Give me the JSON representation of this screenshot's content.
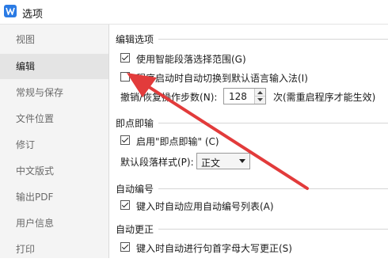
{
  "window": {
    "title": "选项"
  },
  "sidebar": {
    "items": [
      {
        "label": "视图"
      },
      {
        "label": "编辑"
      },
      {
        "label": "常规与保存"
      },
      {
        "label": "文件位置"
      },
      {
        "label": "修订"
      },
      {
        "label": "中文版式"
      },
      {
        "label": "输出PDF"
      },
      {
        "label": "用户信息"
      },
      {
        "label": "打印"
      }
    ],
    "active": "编辑"
  },
  "edit_options": {
    "title": "编辑选项",
    "smart_paragraph": {
      "label": "使用智能段落选择范围(G)",
      "checked": true
    },
    "auto_switch_lang": {
      "label": "程序启动时自动切换到默认语言输入法(I)",
      "checked": false
    },
    "undo_steps": {
      "label": "撤销/恢复操作步数(N):",
      "value": "128",
      "suffix": "次(需重启程序才能生效)"
    }
  },
  "click_type": {
    "title": "即点即输",
    "enable": {
      "label": "启用\"即点即输\" (C)",
      "checked": true
    },
    "default_style": {
      "label": "默认段落样式(P):",
      "value": "正文"
    }
  },
  "auto_numbering": {
    "title": "自动编号",
    "apply_list": {
      "label": "键入时自动应用自动编号列表(A)",
      "checked": true
    }
  },
  "auto_correct": {
    "title": "自动更正",
    "capitalize": {
      "label": "键入时自动进行句首字母大写更正(S)",
      "checked": true
    }
  },
  "colors": {
    "accent": "#2b7be4",
    "annotation_arrow": "#e23b3b"
  }
}
